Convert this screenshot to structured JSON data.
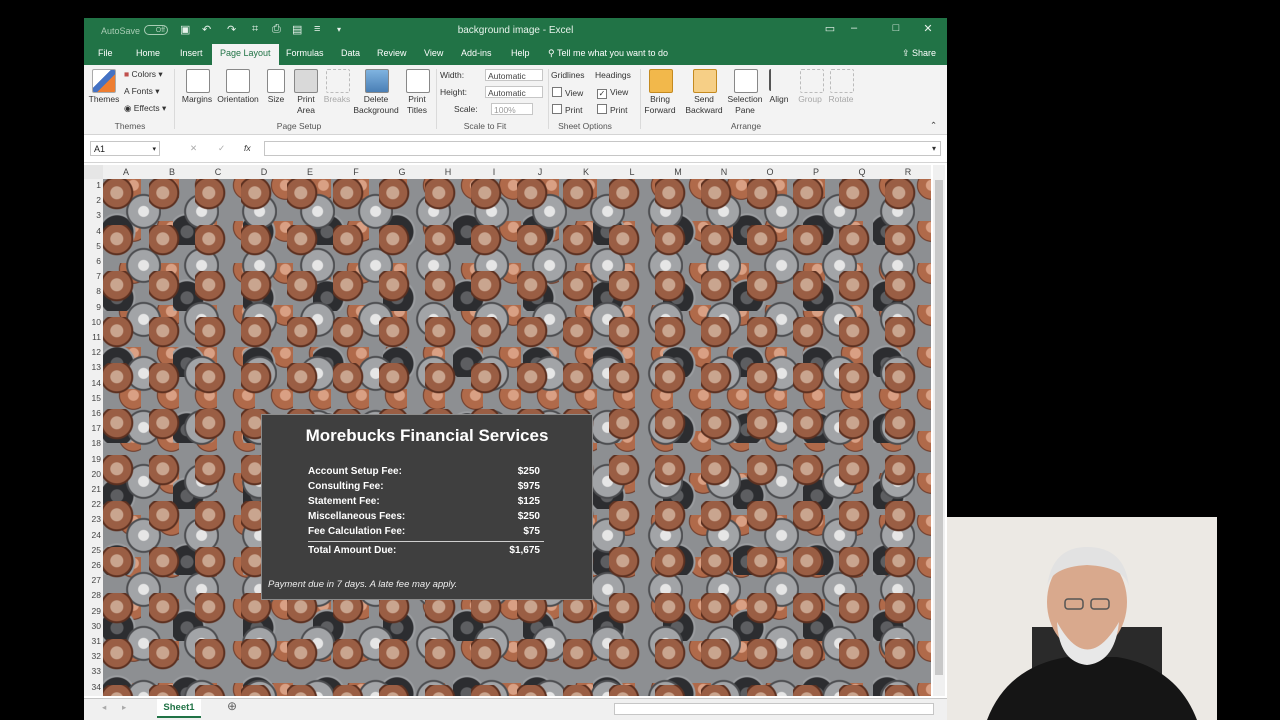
{
  "window": {
    "title": "background image  -  Excel",
    "autosave_label": "AutoSave",
    "autosave_state": "Off"
  },
  "tabs": [
    "File",
    "Home",
    "Insert",
    "Page Layout",
    "Formulas",
    "Data",
    "Review",
    "View",
    "Add-ins",
    "Help"
  ],
  "active_tab": "Page Layout",
  "tell_me": "Tell me what you want to do",
  "share": "Share",
  "ribbon": {
    "themes": {
      "themes": "Themes",
      "colors": "Colors",
      "fonts": "Fonts",
      "effects": "Effects",
      "group": "Themes"
    },
    "page_setup": {
      "margins": "Margins",
      "orientation": "Orientation",
      "size": "Size",
      "print_area": "Print Area",
      "breaks": "Breaks",
      "delete_background": "Delete Background",
      "print_titles": "Print Titles",
      "group": "Page Setup"
    },
    "scale_to_fit": {
      "width_label": "Width:",
      "width_value": "Automatic",
      "height_label": "Height:",
      "height_value": "Automatic",
      "scale_label": "Scale:",
      "scale_value": "100%",
      "group": "Scale to Fit"
    },
    "sheet_options": {
      "gridlines": "Gridlines",
      "headings": "Headings",
      "view": "View",
      "print": "Print",
      "group": "Sheet Options"
    },
    "arrange": {
      "bring_forward": "Bring Forward",
      "send_backward": "Send Backward",
      "selection_pane": "Selection Pane",
      "align": "Align",
      "group_btn": "Group",
      "rotate": "Rotate",
      "group": "Arrange"
    }
  },
  "formula_bar": {
    "name_box": "A1",
    "fx": "fx",
    "cancel": "✕",
    "enter": "✓"
  },
  "columns": [
    "A",
    "B",
    "C",
    "D",
    "E",
    "F",
    "G",
    "H",
    "I",
    "J",
    "K",
    "L",
    "M",
    "N",
    "O",
    "P",
    "Q",
    "R"
  ],
  "rows": [
    "1",
    "2",
    "3",
    "4",
    "5",
    "6",
    "7",
    "8",
    "9",
    "10",
    "11",
    "12",
    "13",
    "14",
    "15",
    "16",
    "17",
    "18",
    "19",
    "20",
    "21",
    "22",
    "23",
    "24",
    "25",
    "26",
    "27",
    "28",
    "29",
    "30",
    "31",
    "32",
    "33",
    "34"
  ],
  "invoice": {
    "title": "Morebucks Financial Services",
    "fees": [
      {
        "label": "Account Setup Fee:",
        "value": "$250"
      },
      {
        "label": "Consulting Fee:",
        "value": "$975"
      },
      {
        "label": "Statement Fee:",
        "value": "$125"
      },
      {
        "label": "Miscellaneous Fees:",
        "value": "$250"
      },
      {
        "label": "Fee Calculation Fee:",
        "value": "$75"
      }
    ],
    "total_label": "Total Amount Due:",
    "total_value": "$1,675",
    "note": "Payment due in 7 days. A late fee may apply."
  },
  "sheet_tab": "Sheet1",
  "colors": {
    "excel_green": "#217346",
    "card_bg": "#3f3f3f"
  }
}
